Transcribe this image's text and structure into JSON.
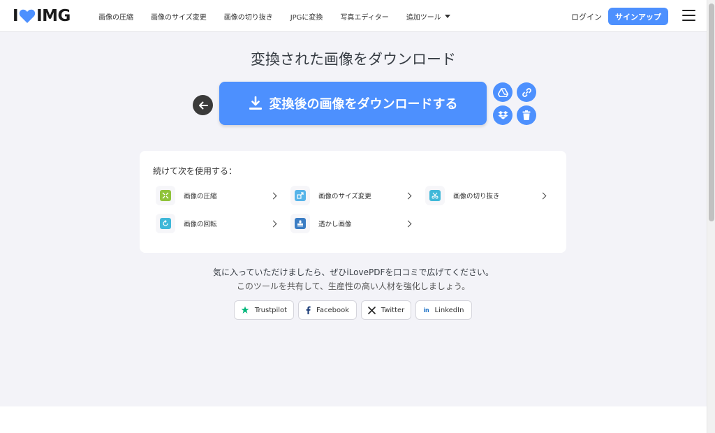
{
  "header": {
    "logo_left": "I",
    "logo_right": "IMG",
    "nav": [
      {
        "label": "画像の圧縮"
      },
      {
        "label": "画像のサイズ変更"
      },
      {
        "label": "画像の切り抜き"
      },
      {
        "label": "JPGに変換"
      },
      {
        "label": "写真エディター"
      },
      {
        "label": "追加ツール"
      }
    ],
    "login_label": "ログイン",
    "signup_label": "サインアップ"
  },
  "main": {
    "title": "変換された画像をダウンロード",
    "download_label": "変換後の画像をダウンロードする"
  },
  "continue_card": {
    "title": "続けて次を使用する：",
    "tools": [
      {
        "label": "画像の圧縮",
        "icon": "compress-icon",
        "color": "#8fc33a"
      },
      {
        "label": "画像のサイズ変更",
        "icon": "resize-icon",
        "color": "#56b4e9"
      },
      {
        "label": "画像の切り抜き",
        "icon": "crop-icon",
        "color": "#3fb8d8"
      },
      {
        "label": "画像の回転",
        "icon": "rotate-icon",
        "color": "#3fb8d8"
      },
      {
        "label": "透かし画像",
        "icon": "watermark-icon",
        "color": "#3b7dc4"
      }
    ]
  },
  "share": {
    "line1": "気に入っていただけましたら、ぜひiLovePDFを口コミで広げてください。",
    "line2": "このツールを共有して、生産性の高い人材を強化しましょう。",
    "buttons": [
      {
        "label": "Trustpilot"
      },
      {
        "label": "Facebook"
      },
      {
        "label": "Twitter"
      },
      {
        "label": "LinkedIn"
      }
    ]
  },
  "colors": {
    "accent": "#4d90fe",
    "logo_heart": "#4d90fe",
    "background": "#f3f3f8"
  }
}
